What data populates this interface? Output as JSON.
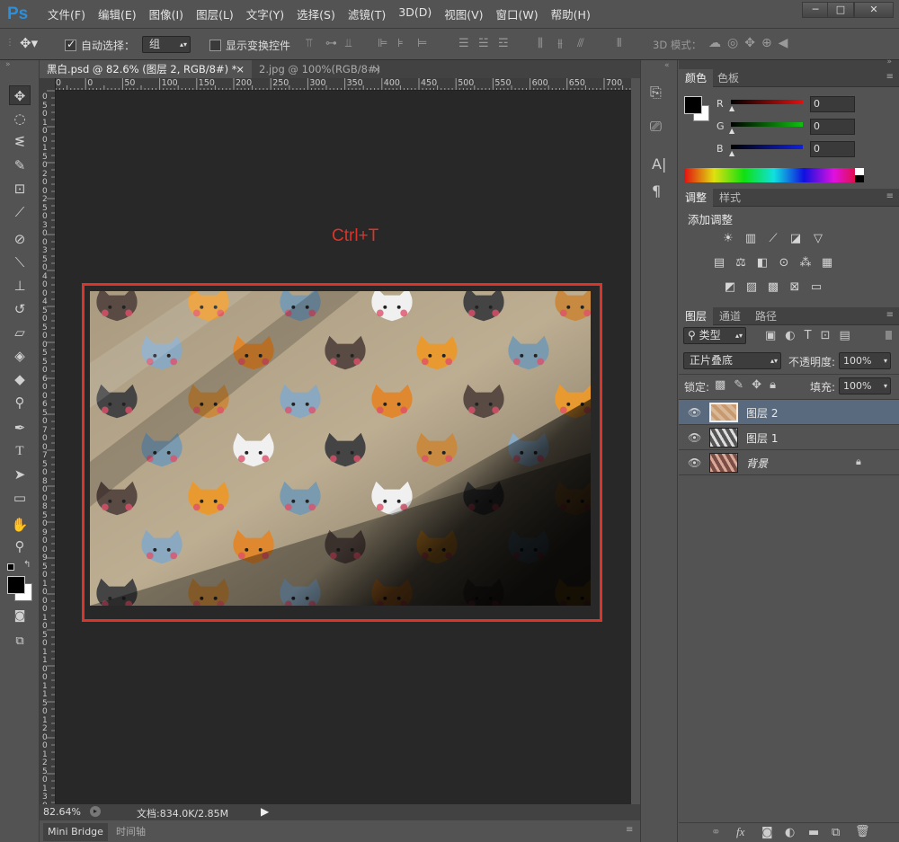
{
  "app": {
    "logo": "Ps"
  },
  "menu": [
    "文件(F)",
    "编辑(E)",
    "图像(I)",
    "图层(L)",
    "文字(Y)",
    "选择(S)",
    "滤镜(T)",
    "3D(D)",
    "视图(V)",
    "窗口(W)",
    "帮助(H)"
  ],
  "window_controls": {
    "minimize": "─",
    "maximize": "□",
    "close": "✕"
  },
  "options": {
    "auto_select_label": "自动选择：",
    "auto_select_value": "组",
    "show_transform_label": "显示变换控件",
    "mode3d_label": "3D 模式："
  },
  "doc_tabs": [
    {
      "label": "黑白.psd @ 82.6% (图层 2, RGB/8#) *",
      "close": "×"
    },
    {
      "label": "2.jpg @ 100%(RGB/8#)",
      "close": "×"
    }
  ],
  "ruler_h": [
    "50",
    "0",
    "50",
    "100",
    "150",
    "200",
    "250",
    "300",
    "350",
    "400",
    "450",
    "500",
    "550",
    "600",
    "650",
    "700"
  ],
  "ruler_v": [
    "0",
    "5",
    "0",
    "1",
    "0",
    "0",
    "1",
    "5",
    "0",
    "2",
    "0",
    "0",
    "2",
    "5",
    "0",
    "3",
    "0",
    "0",
    "3",
    "5",
    "0",
    "4",
    "0",
    "0",
    "4",
    "5",
    "0",
    "5",
    "0",
    "0",
    "5",
    "5",
    "0",
    "6",
    "0",
    "0",
    "6",
    "5",
    "0",
    "7",
    "0",
    "0",
    "7",
    "5",
    "0",
    "8",
    "0",
    "0",
    "8",
    "5",
    "0",
    "9",
    "0",
    "0",
    "9",
    "5",
    "0",
    "1",
    "0",
    "0",
    "0",
    "1",
    "0",
    "5",
    "0",
    "1",
    "1",
    "0",
    "0",
    "1",
    "1",
    "5",
    "0",
    "1",
    "2",
    "0",
    "0",
    "1",
    "2",
    "5",
    "0",
    "1",
    "3",
    "0",
    "0",
    "1",
    "3",
    "5",
    "0"
  ],
  "annotation": {
    "text": "Ctrl+T",
    "color": "#d9352a"
  },
  "status": {
    "zoom": "82.64%",
    "doc_info": "文档:834.0K/2.85M"
  },
  "bottom_tabs": [
    "Mini Bridge",
    "时间轴"
  ],
  "color_panel": {
    "tabs": [
      "颜色",
      "色板"
    ],
    "channels": [
      {
        "name": "R",
        "value": "0",
        "color": "#e01010"
      },
      {
        "name": "G",
        "value": "0",
        "color": "#10c010"
      },
      {
        "name": "B",
        "value": "0",
        "color": "#1020e0"
      }
    ]
  },
  "adjust_panel": {
    "tabs": [
      "调整",
      "样式"
    ],
    "title": "添加调整"
  },
  "layers_panel": {
    "tabs": [
      "图层",
      "通道",
      "路径"
    ],
    "filter_label": "类型",
    "blend_mode": "正片叠底",
    "opacity_label": "不透明度:",
    "opacity_value": "100%",
    "lock_label": "锁定:",
    "fill_label": "填充:",
    "fill_value": "100%",
    "layers": [
      {
        "name": "图层 2",
        "selected": true
      },
      {
        "name": "图层 1",
        "selected": false
      },
      {
        "name": "背景",
        "selected": false
      }
    ]
  },
  "colors": {
    "accent_red": "#d9352a",
    "selection_blue": "#5a6a7e",
    "canvas_bg": "#282828"
  }
}
